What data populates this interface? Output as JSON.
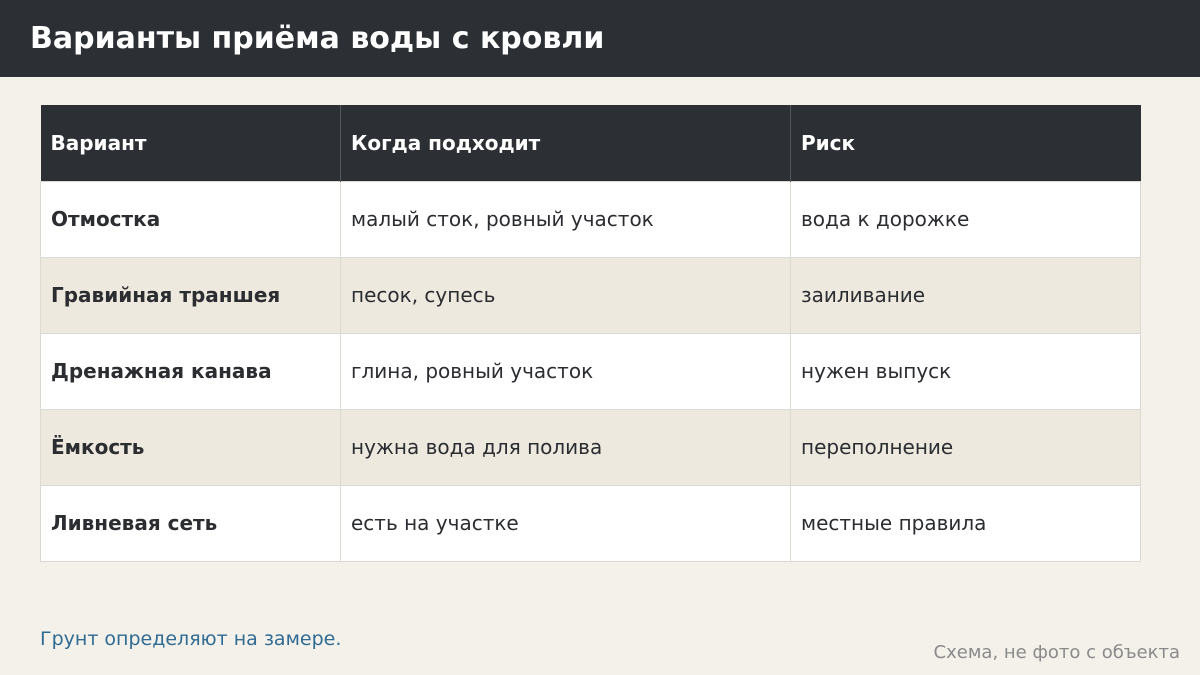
{
  "header": {
    "title": "Варианты приёма воды с кровли"
  },
  "table": {
    "columns": [
      "Вариант",
      "Когда подходит",
      "Риск"
    ],
    "rows": [
      [
        "Отмостка",
        "малый сток, ровный участок",
        "вода к дорожке"
      ],
      [
        "Гравийная траншея",
        "песок, супесь",
        "заиливание"
      ],
      [
        "Дренажная канава",
        "глина, ровный участок",
        "нужен выпуск"
      ],
      [
        "Ёмкость",
        "нужна вода для полива",
        "переполнение"
      ],
      [
        "Ливневая сеть",
        "есть на участке",
        "местные правила"
      ]
    ]
  },
  "footer": {
    "note": "Грунт определяют на замере.",
    "caption": "Схема, не фото с объекта"
  }
}
